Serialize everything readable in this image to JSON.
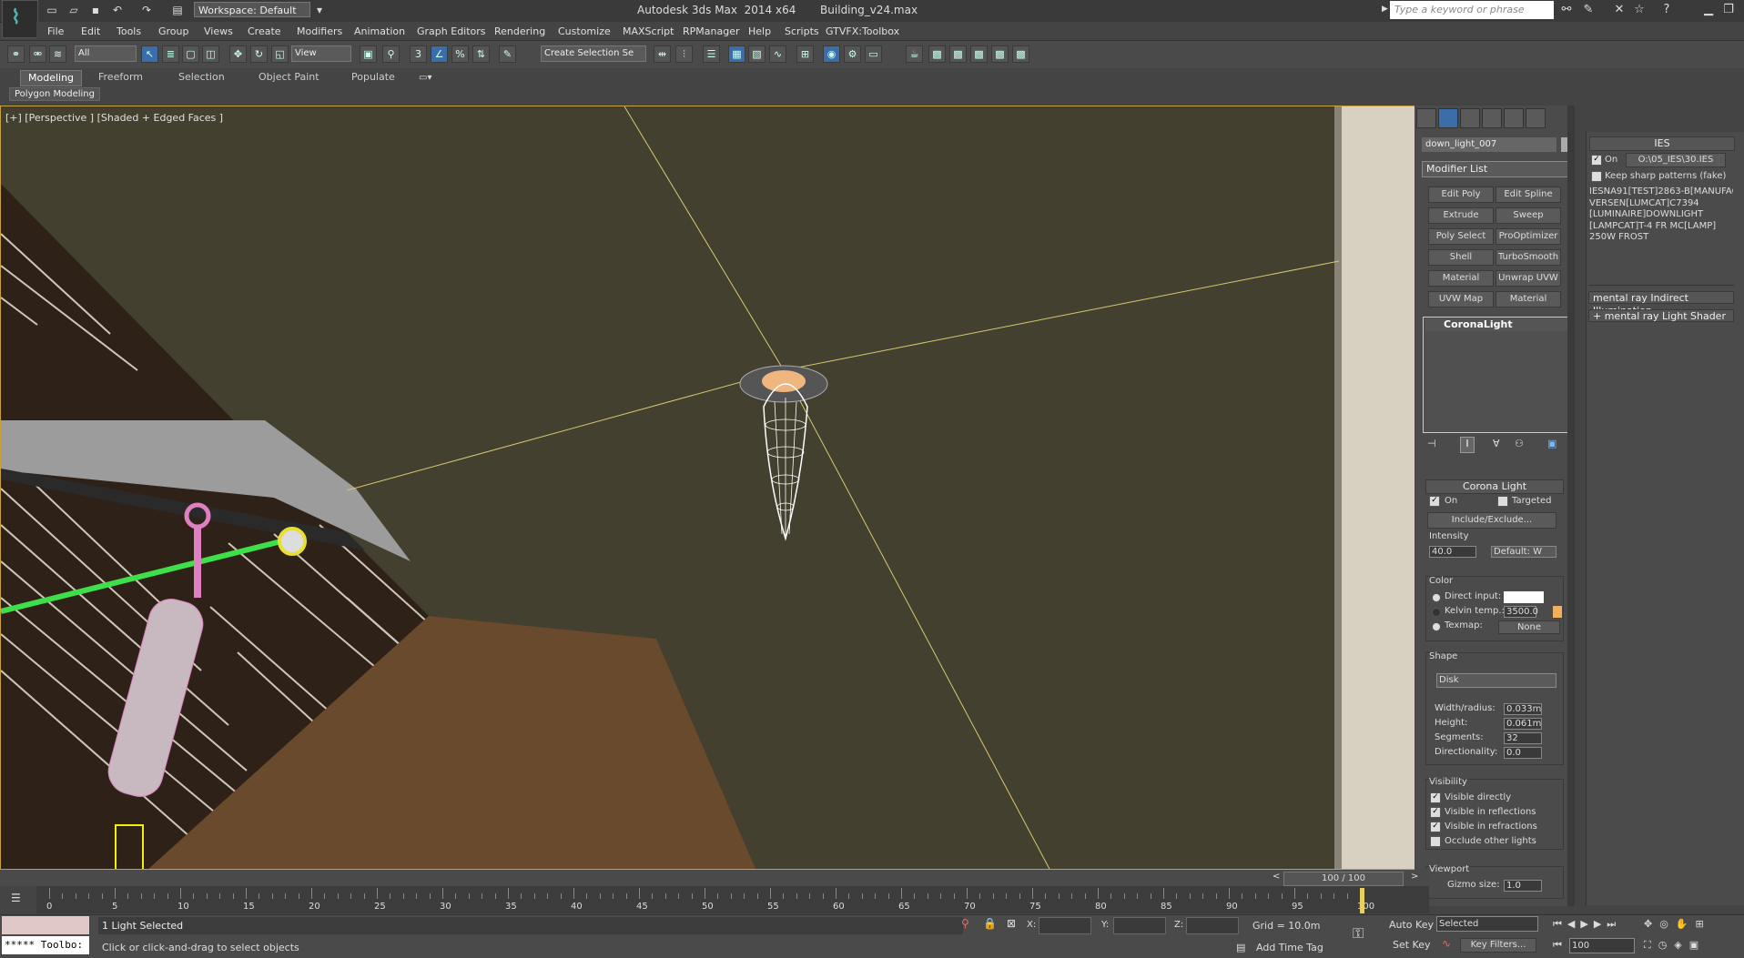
{
  "titlebar": {
    "workspace": "Workspace: Default",
    "title": "Autodesk 3ds Max  2014 x64       Building_v24.max",
    "search_placeholder": "Type a keyword or phrase"
  },
  "menu": [
    "File",
    "Edit",
    "Tools",
    "Group",
    "Views",
    "Create",
    "Modifiers",
    "Animation",
    "Graph Editors",
    "Rendering",
    "Customize",
    "MAXScript",
    "RPManager",
    "Help",
    "Scripts",
    "GTVFX:Toolbox"
  ],
  "toolbar": {
    "filter": "All",
    "ref_coord": "View",
    "selection_set": "Create Selection Se"
  },
  "ribbon": {
    "tabs": [
      "Modeling",
      "Freeform",
      "Selection",
      "Object Paint",
      "Populate"
    ],
    "panel": "Polygon Modeling"
  },
  "viewport": {
    "label": "[+] [Perspective ] [Shaded + Edged Faces ]"
  },
  "command_panel": {
    "object_name": "down_light_007",
    "modifier_list": "Modifier List",
    "buttons": [
      "Edit Poly",
      "Edit Spline",
      "Extrude",
      "Sweep",
      "Poly Select",
      "ProOptimizer",
      "Shell",
      "TurboSmooth",
      "Material",
      "Unwrap UVW",
      "UVW Map",
      "Material"
    ],
    "stack_item": "CoronaLight",
    "rollout_title": "Corona Light",
    "on_label": "On",
    "targeted_label": "Targeted",
    "include_exclude": "Include/Exclude...",
    "intensity_label": "Intensity",
    "intensity_value": "40.0",
    "intensity_unit": "Default: W",
    "color_label": "Color",
    "direct_input": "Direct input:",
    "kelvin_label": "Kelvin temp.:",
    "kelvin_value": "3500.0",
    "texmap_label": "Texmap:",
    "texmap_value": "None",
    "shape_label": "Shape",
    "shape_value": "Disk",
    "width_label": "Width/radius:",
    "width_value": "0.033m",
    "height_label": "Height:",
    "height_value": "0.061m",
    "segments_label": "Segments:",
    "segments_value": "32",
    "directionality_label": "Directionality:",
    "directionality_value": "0.0",
    "visibility_label": "Visibility",
    "vis_items": [
      "Visible directly",
      "Visible in reflections",
      "Visible in refractions",
      "Occlude other lights"
    ],
    "viewport_label": "Viewport",
    "gizmo_label": "Gizmo size:",
    "gizmo_value": "1.0"
  },
  "ies_panel": {
    "title": "IES",
    "on_label": "On",
    "file": "O:\\05_IES\\30.IES",
    "sharp_label": "Keep sharp patterns (fake)",
    "info_lines": [
      "IESNA91[TEST]2863-B[MANUFAC",
      "VERSEN[LUMCAT]C7394",
      "[LUMINAIRE]DOWNLIGHT",
      "[LAMPCAT]T-4 FR MC[LAMP]",
      "250W FROST"
    ],
    "rollout1": "mental ray Indirect Illumination",
    "rollout2": "mental ray Light Shader"
  },
  "timeline": {
    "frame": "100 / 100",
    "ticks": [
      "0",
      "5",
      "10",
      "15",
      "20",
      "25",
      "30",
      "35",
      "40",
      "45",
      "50",
      "55",
      "60",
      "65",
      "70",
      "75",
      "80",
      "85",
      "90",
      "95",
      "100"
    ]
  },
  "status": {
    "script_listener": "***** Toolbo:",
    "selected": "1 Light Selected",
    "prompt": "Click or click-and-drag to select objects",
    "x_label": "X:",
    "y_label": "Y:",
    "z_label": "Z:",
    "grid": "Grid = 10.0m",
    "add_time_tag": "Add Time Tag",
    "auto_key": "Auto Key",
    "set_key": "Set Key",
    "selected_dd": "Selected",
    "key_filters": "Key Filters...",
    "frame_value": "100"
  },
  "colors": {
    "accent_active": "#3b6da8",
    "viewport_border": "#c9a040",
    "kelvin_swatch": "#f0b060"
  }
}
